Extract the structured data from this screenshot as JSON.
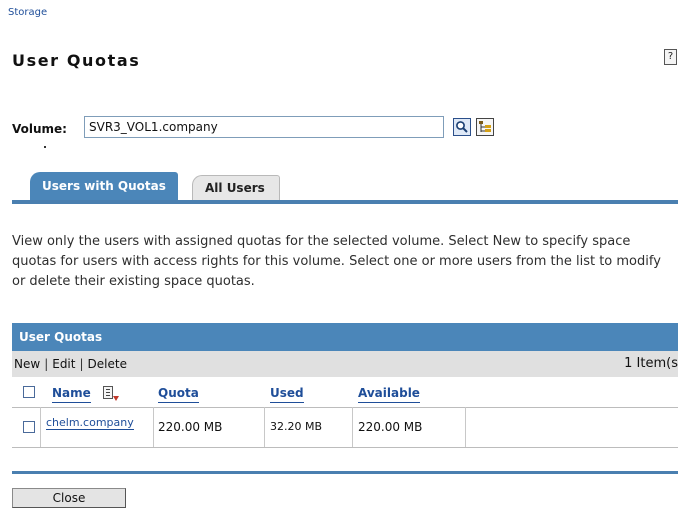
{
  "breadcrumb": "Storage",
  "page_title": "User Quotas",
  "help_glyph": "?",
  "volume": {
    "label": "Volume:",
    "value": "SVR3_VOL1.company"
  },
  "tabs": [
    {
      "label": "Users with Quotas",
      "active": true
    },
    {
      "label": "All Users",
      "active": false
    }
  ],
  "description": "View only the users with assigned quotas for the selected volume. Select New to specify space quotas for users with access rights for this volume. Select one or more users from the list to modify or delete their existing space quotas.",
  "table": {
    "title": "User Quotas",
    "actions": {
      "new": "New",
      "edit": "Edit",
      "delete": "Delete"
    },
    "item_count": "1 Item(s",
    "columns": [
      "Name",
      "Quota",
      "Used",
      "Available"
    ],
    "rows": [
      {
        "name": "chelm.company",
        "quota": "220.00 MB",
        "used": "32.20 MB",
        "available": "220.00 MB"
      }
    ]
  },
  "close_label": "Close",
  "colors": {
    "accent": "#4b86b9",
    "link": "#1f4e99",
    "toolbar": "#e0e0e0"
  }
}
